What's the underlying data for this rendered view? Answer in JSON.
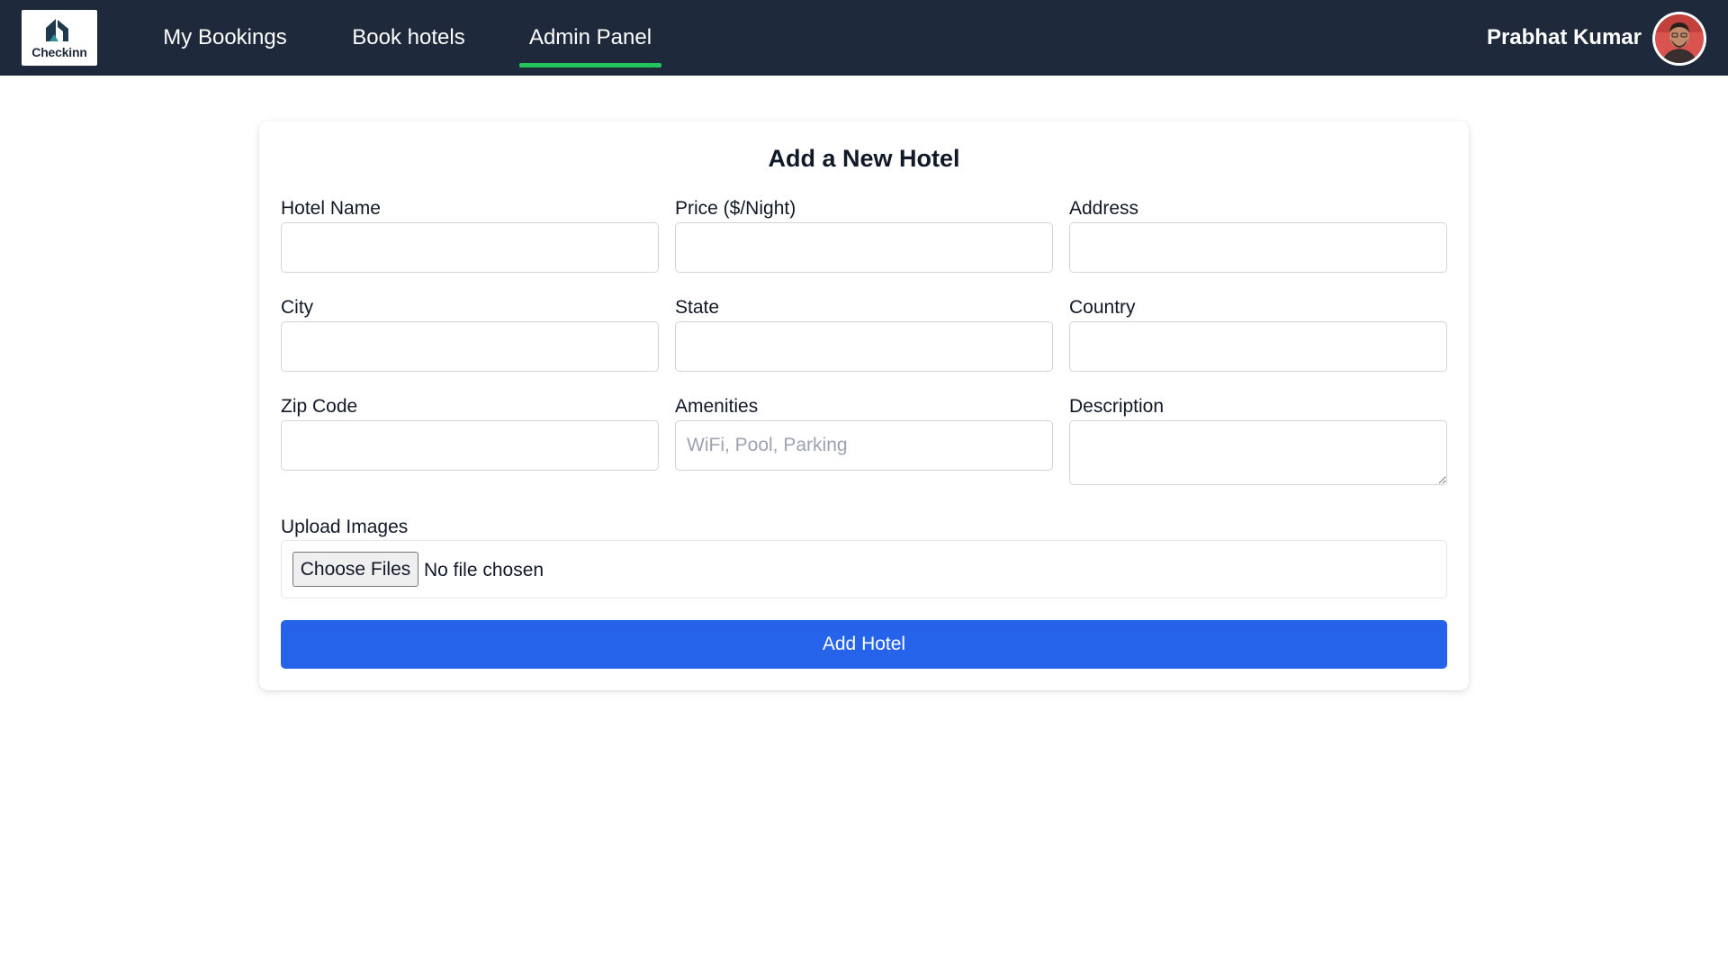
{
  "navbar": {
    "logo_text": "Checkinn",
    "links": [
      {
        "label": "My Bookings"
      },
      {
        "label": "Book hotels"
      },
      {
        "label": "Admin Panel",
        "active": true
      }
    ],
    "user_name": "Prabhat Kumar"
  },
  "form": {
    "title": "Add a New Hotel",
    "fields": {
      "hotel_name": {
        "label": "Hotel Name",
        "value": "",
        "placeholder": ""
      },
      "price": {
        "label": "Price ($/Night)",
        "value": "",
        "placeholder": ""
      },
      "address": {
        "label": "Address",
        "value": "",
        "placeholder": ""
      },
      "city": {
        "label": "City",
        "value": "",
        "placeholder": ""
      },
      "state": {
        "label": "State",
        "value": "",
        "placeholder": ""
      },
      "country": {
        "label": "Country",
        "value": "",
        "placeholder": ""
      },
      "zip_code": {
        "label": "Zip Code",
        "value": "",
        "placeholder": ""
      },
      "amenities": {
        "label": "Amenities",
        "value": "",
        "placeholder": "WiFi, Pool, Parking"
      },
      "description": {
        "label": "Description",
        "value": "",
        "placeholder": ""
      }
    },
    "upload": {
      "label": "Upload Images",
      "button_label": "Choose Files",
      "status": "No file chosen"
    },
    "submit_label": "Add Hotel"
  },
  "colors": {
    "navbar_bg": "#1e293b",
    "active_underline": "#22c55e",
    "primary_button": "#2563eb"
  },
  "icons": {
    "logo": "house-logo-icon",
    "avatar": "user-avatar"
  }
}
